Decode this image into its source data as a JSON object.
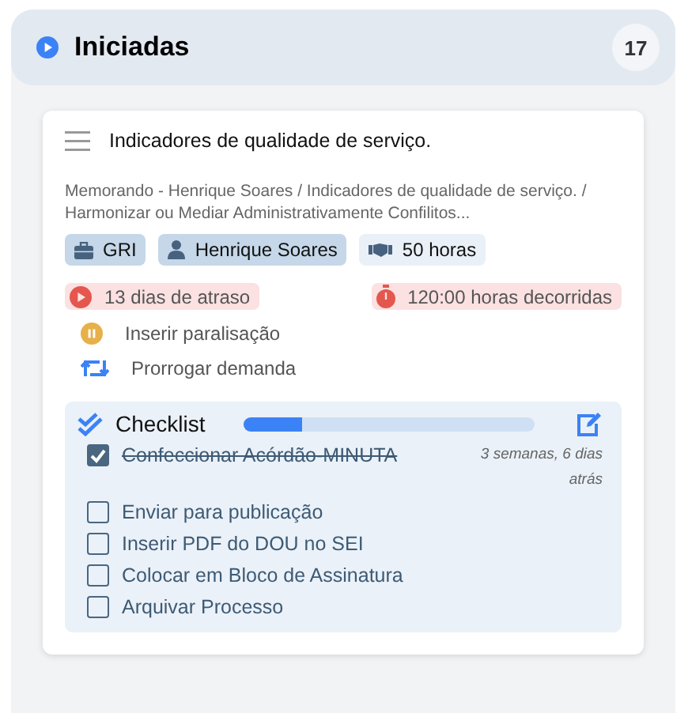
{
  "column": {
    "title": "Iniciadas",
    "count": "17"
  },
  "card": {
    "title": "Indicadores de qualidade de serviço.",
    "path": "Memorando - Henrique Soares / Indicadores de qualidade de serviço. / Harmonizar ou Mediar Administrativamente Confilitos...",
    "tags": [
      {
        "kind": "sector",
        "label": "GRI"
      },
      {
        "kind": "person",
        "label": "Henrique Soares"
      },
      {
        "kind": "hours",
        "label": "50 horas"
      }
    ],
    "alerts": [
      {
        "kind": "delay",
        "label": "13 dias de atraso"
      },
      {
        "kind": "elapsed",
        "label": "120:00 horas decorridas"
      }
    ],
    "actions": [
      {
        "kind": "pause",
        "label": "Inserir paralisação"
      },
      {
        "kind": "extend",
        "label": "Prorrogar demanda"
      }
    ],
    "checklist": {
      "title": "Checklist",
      "level": 0.2,
      "items": [
        {
          "label": "Confeccionar Acórdão-MINUTA",
          "checked": true,
          "note": "3 semanas, 6 dias atrás"
        },
        {
          "label": "Enviar para publicação",
          "checked": false
        },
        {
          "label": "Inserir PDF do DOU no SEI",
          "checked": false
        },
        {
          "label": "Colocar em Bloco de Assinatura",
          "checked": false
        },
        {
          "label": "Arquivar Processo",
          "checked": false
        }
      ]
    }
  }
}
